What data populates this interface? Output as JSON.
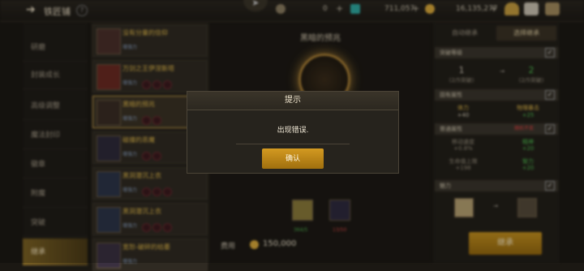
{
  "header": {
    "title": "铁匠铺",
    "resources": [
      {
        "name": "gold",
        "value": "0",
        "color": "#b8a88a"
      },
      {
        "name": "gem",
        "value": "711,057",
        "color": "#2fa8a0"
      },
      {
        "name": "coin",
        "value": "16,135,277",
        "color": "#d9a83a"
      }
    ]
  },
  "nav": {
    "items": [
      "研磨",
      "封装成长",
      "高级调整",
      "魔法封印",
      "徽章",
      "附魔",
      "突破",
      "继承"
    ],
    "active_index": 7
  },
  "list": {
    "items": [
      {
        "name": "没有分量的信仰",
        "sub": "增强力",
        "selected": false
      },
      {
        "name": "万剑之王伊涅斯塔",
        "sub": "增强力",
        "selected": false
      },
      {
        "name": "黑暗的预兆",
        "sub": "增强力",
        "selected": true
      },
      {
        "name": "碰撞的恶魔",
        "sub": "增强力",
        "selected": false
      },
      {
        "name": "黑洞潜沉上衣",
        "sub": "增强力",
        "selected": false
      },
      {
        "name": "黑洞潜沉上衣",
        "sub": "增强力",
        "selected": false
      },
      {
        "name": "宽恕-破碎的枯萎",
        "sub": "增强力",
        "selected": false
      }
    ]
  },
  "center": {
    "title": "黑暗的预兆",
    "materials": [
      {
        "count": "364/5",
        "color": "#4fb04f"
      },
      {
        "count": "13/50",
        "color": "#d04444"
      }
    ],
    "cost_label": "费用",
    "cost_value": "150,000"
  },
  "right": {
    "tabs": [
      "自动继承",
      "选择继承"
    ],
    "sections": {
      "s1": {
        "title": "突破等级",
        "left": "1",
        "left_sub": "(2/5突破)",
        "right": "2",
        "right_sub": "(2/5突破)"
      },
      "s2": {
        "title": "固有属性",
        "l1": "体力",
        "l2": "+40",
        "r1": "物理暴击",
        "r2": "+25"
      },
      "s3": {
        "title": "普通属性",
        "badge": "随机不卖",
        "l1": "移动速度",
        "l2": "+0.8%",
        "l3": "生命值上限",
        "l4": "+198",
        "r1": "精神",
        "r2": "+20",
        "r3": "智力",
        "r4": "+20"
      },
      "s4": {
        "title": "魅力"
      }
    },
    "button": "继承"
  },
  "dialog": {
    "title": "提示",
    "message": "出现错误.",
    "confirm": "确认"
  }
}
